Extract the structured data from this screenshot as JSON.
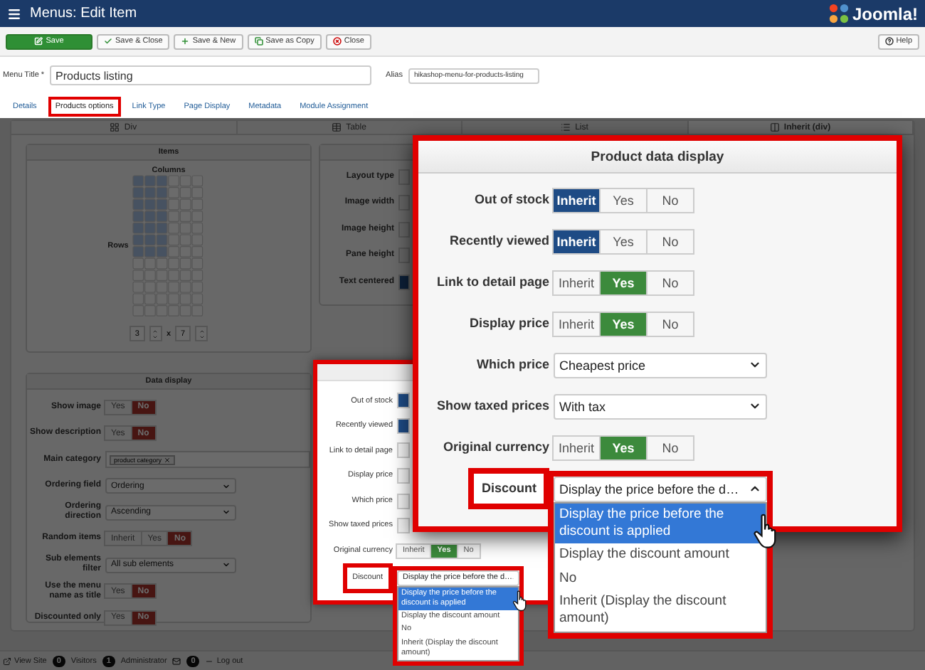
{
  "window": {
    "title": "Menus: Edit Item",
    "logo": "Joomla!"
  },
  "toolbar": [
    {
      "label": "Save",
      "kind": "primary"
    },
    {
      "label": "Save & Close",
      "kind": "default"
    },
    {
      "label": "Save & New",
      "kind": "default"
    },
    {
      "label": "Save as Copy",
      "kind": "default"
    },
    {
      "label": "Close",
      "kind": "default"
    }
  ],
  "help_button": "Help",
  "menu_title": {
    "label": "Menu Title *",
    "value": "Products listing"
  },
  "alias": {
    "label": "Alias",
    "value": "hikashop-menu-for-products-listing"
  },
  "tabs": [
    {
      "label": "Details",
      "selected": false
    },
    {
      "label": "Products options",
      "selected": true
    },
    {
      "label": "Link Type",
      "selected": false
    },
    {
      "label": "Page Display",
      "selected": false
    },
    {
      "label": "Metadata",
      "selected": false
    },
    {
      "label": "Module Assignment",
      "selected": false
    }
  ],
  "layout_tabs": [
    {
      "label": "Div",
      "selected": false
    },
    {
      "label": "Table",
      "selected": false
    },
    {
      "label": "List",
      "selected": false
    },
    {
      "label": "Inherit (div)",
      "selected": true
    }
  ],
  "items_panel": {
    "title": "Items",
    "columns_label": "Columns",
    "rows_label": "Rows",
    "columns_value": "3",
    "times": "x",
    "rows_value": "7"
  },
  "settings_panel": {
    "fields": [
      {
        "label": "Layout type",
        "kind": "cut",
        "highlighted": false
      },
      {
        "label": "Image width",
        "kind": "cut",
        "highlighted": false
      },
      {
        "label": "Image height",
        "kind": "cut",
        "highlighted": false
      },
      {
        "label": "Pane height",
        "kind": "cut",
        "highlighted": false
      },
      {
        "label": "Text centered",
        "kind": "cut",
        "highlighted": true
      }
    ]
  },
  "data_display": {
    "title": "Data display",
    "fields": [
      {
        "label": "Show image",
        "kind": "toggle",
        "options": [
          {
            "label": "Yes",
            "selected": false
          },
          {
            "label": "No",
            "selected": true
          }
        ]
      },
      {
        "label": "Show description",
        "kind": "toggle",
        "options": [
          {
            "label": "Yes",
            "selected": false
          },
          {
            "label": "No",
            "selected": true
          }
        ]
      },
      {
        "label": "Main category",
        "kind": "tags",
        "tags": [
          "product category"
        ]
      },
      {
        "label": "Ordering field",
        "kind": "select",
        "value": "Ordering"
      },
      {
        "label": "Ordering direction",
        "kind": "select",
        "value": "Ascending"
      },
      {
        "label": "Random items",
        "kind": "toggle",
        "options": [
          {
            "label": "Inherit",
            "selected": false
          },
          {
            "label": "Yes",
            "selected": false
          },
          {
            "label": "No",
            "selected": true
          }
        ]
      },
      {
        "label": "Sub elements filter",
        "kind": "select",
        "value": "All sub elements"
      },
      {
        "label": "Use the menu name as title",
        "kind": "toggle",
        "options": [
          {
            "label": "Yes",
            "selected": false
          },
          {
            "label": "No",
            "selected": true
          }
        ]
      },
      {
        "label": "Discounted only",
        "kind": "toggle",
        "options": [
          {
            "label": "Yes",
            "selected": false
          },
          {
            "label": "No",
            "selected": true
          }
        ]
      }
    ]
  },
  "small_callout": {
    "fields": [
      {
        "label": "Out of stock",
        "kind": "cut",
        "highlighted": true
      },
      {
        "label": "Recently viewed",
        "kind": "cut",
        "highlighted": true
      },
      {
        "label": "Link to detail page",
        "kind": "cut",
        "highlighted": false
      },
      {
        "label": "Display price",
        "kind": "cut",
        "highlighted": false
      },
      {
        "label": "Which price",
        "kind": "cut",
        "highlighted": false
      },
      {
        "label": "Show taxed prices",
        "kind": "cut",
        "highlighted": false
      },
      {
        "label": "Original currency",
        "kind": "toggle",
        "options": [
          {
            "label": "Inherit",
            "selected": false
          },
          {
            "label": "Yes",
            "selected": true
          },
          {
            "label": "No",
            "selected": false
          }
        ]
      },
      {
        "label": "Discount",
        "kind": "select_open",
        "highlighted": true,
        "value": "Display the price before the d…",
        "options": [
          {
            "label": "Display the price before the discount is applied",
            "selected": true
          },
          {
            "label": "Display the discount amount",
            "selected": false
          },
          {
            "label": "No",
            "selected": false
          },
          {
            "label": "Inherit (Display the discount amount)",
            "selected": false
          }
        ]
      }
    ]
  },
  "product_data_display": {
    "title": "Product data display",
    "fields": [
      {
        "label": "Out of stock",
        "kind": "toggle",
        "options": [
          {
            "label": "Inherit",
            "selected": true
          },
          {
            "label": "Yes",
            "selected": false
          },
          {
            "label": "No",
            "selected": false
          }
        ]
      },
      {
        "label": "Recently viewed",
        "kind": "toggle",
        "options": [
          {
            "label": "Inherit",
            "selected": true
          },
          {
            "label": "Yes",
            "selected": false
          },
          {
            "label": "No",
            "selected": false
          }
        ]
      },
      {
        "label": "Link to detail page",
        "kind": "toggle",
        "options": [
          {
            "label": "Inherit",
            "selected": false
          },
          {
            "label": "Yes",
            "selected": true
          },
          {
            "label": "No",
            "selected": false
          }
        ]
      },
      {
        "label": "Display price",
        "kind": "toggle",
        "options": [
          {
            "label": "Inherit",
            "selected": false
          },
          {
            "label": "Yes",
            "selected": true
          },
          {
            "label": "No",
            "selected": false
          }
        ]
      },
      {
        "label": "Which price",
        "kind": "select",
        "value": "Cheapest price"
      },
      {
        "label": "Show taxed prices",
        "kind": "select",
        "value": "With tax"
      },
      {
        "label": "Original currency",
        "kind": "toggle",
        "options": [
          {
            "label": "Inherit",
            "selected": false
          },
          {
            "label": "Yes",
            "selected": true
          },
          {
            "label": "No",
            "selected": false
          }
        ]
      },
      {
        "label": "Discount",
        "kind": "select_open",
        "highlighted": true,
        "value": "Display the price before the d…",
        "options": [
          {
            "label": "Display the price before the discount is applied",
            "selected": true
          },
          {
            "label": "Display the discount amount",
            "selected": false
          },
          {
            "label": "No",
            "selected": false
          },
          {
            "label": "Inherit (Display the discount amount)",
            "selected": false
          }
        ]
      }
    ]
  },
  "footer": [
    {
      "kind": "site",
      "label": "View Site"
    },
    {
      "kind": "badge",
      "badge": "0",
      "label": "Visitors"
    },
    {
      "kind": "badge",
      "badge": "1",
      "label": "Administrator"
    },
    {
      "kind": "mail",
      "badge": "0"
    },
    {
      "kind": "logout",
      "label": "Log out"
    }
  ]
}
